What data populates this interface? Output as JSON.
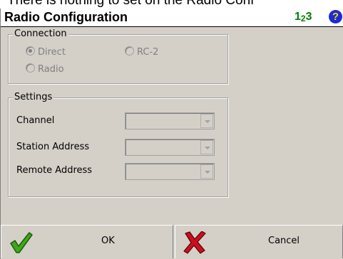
{
  "background_text": "There is nothing to set on the Radio Conf",
  "window": {
    "title": "Radio Configuration",
    "input_mode_icon_main": "1",
    "input_mode_icon_sub": "2",
    "input_mode_icon_last": "3",
    "help_icon": "?"
  },
  "connection": {
    "legend": "Connection",
    "options": [
      {
        "label": "Direct",
        "checked": true,
        "enabled": false
      },
      {
        "label": "RC-2",
        "checked": false,
        "enabled": false
      },
      {
        "label": "Radio",
        "checked": false,
        "enabled": false
      }
    ]
  },
  "settings": {
    "legend": "Settings",
    "fields": [
      {
        "label": "Channel",
        "value": ""
      },
      {
        "label": "Station Address",
        "value": ""
      },
      {
        "label": "Remote Address",
        "value": ""
      }
    ]
  },
  "buttons": {
    "ok_label": "OK",
    "cancel_label": "Cancel"
  },
  "colors": {
    "dialog_bg": "#d4d0c8",
    "checkmark": "#3fa71a",
    "cross": "#c8101e",
    "help_bg": "#1a2ad6",
    "input_mode_icon": "#008000"
  },
  "icons": [
    "numbers-icon",
    "help-icon",
    "checkmark-icon",
    "cross-icon"
  ]
}
